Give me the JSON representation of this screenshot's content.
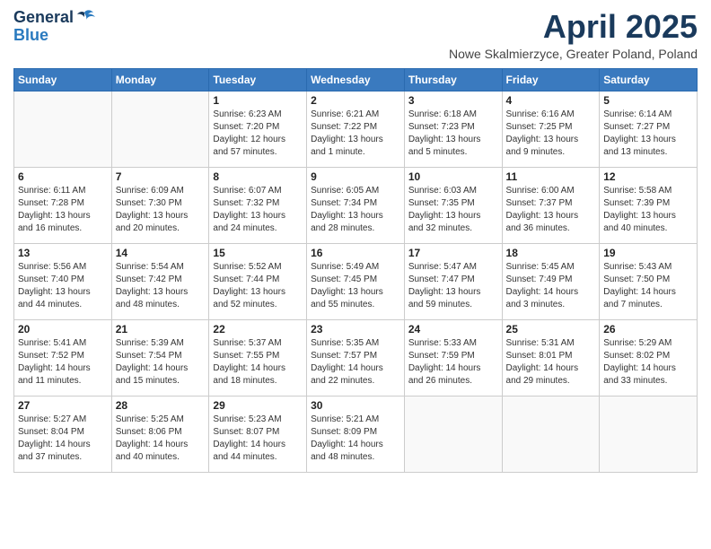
{
  "logo": {
    "general": "General",
    "blue": "Blue"
  },
  "title": "April 2025",
  "subtitle": "Nowe Skalmierzyce, Greater Poland, Poland",
  "days_of_week": [
    "Sunday",
    "Monday",
    "Tuesday",
    "Wednesday",
    "Thursday",
    "Friday",
    "Saturday"
  ],
  "weeks": [
    [
      {
        "day": "",
        "info": ""
      },
      {
        "day": "",
        "info": ""
      },
      {
        "day": "1",
        "info": "Sunrise: 6:23 AM\nSunset: 7:20 PM\nDaylight: 12 hours and 57 minutes."
      },
      {
        "day": "2",
        "info": "Sunrise: 6:21 AM\nSunset: 7:22 PM\nDaylight: 13 hours and 1 minute."
      },
      {
        "day": "3",
        "info": "Sunrise: 6:18 AM\nSunset: 7:23 PM\nDaylight: 13 hours and 5 minutes."
      },
      {
        "day": "4",
        "info": "Sunrise: 6:16 AM\nSunset: 7:25 PM\nDaylight: 13 hours and 9 minutes."
      },
      {
        "day": "5",
        "info": "Sunrise: 6:14 AM\nSunset: 7:27 PM\nDaylight: 13 hours and 13 minutes."
      }
    ],
    [
      {
        "day": "6",
        "info": "Sunrise: 6:11 AM\nSunset: 7:28 PM\nDaylight: 13 hours and 16 minutes."
      },
      {
        "day": "7",
        "info": "Sunrise: 6:09 AM\nSunset: 7:30 PM\nDaylight: 13 hours and 20 minutes."
      },
      {
        "day": "8",
        "info": "Sunrise: 6:07 AM\nSunset: 7:32 PM\nDaylight: 13 hours and 24 minutes."
      },
      {
        "day": "9",
        "info": "Sunrise: 6:05 AM\nSunset: 7:34 PM\nDaylight: 13 hours and 28 minutes."
      },
      {
        "day": "10",
        "info": "Sunrise: 6:03 AM\nSunset: 7:35 PM\nDaylight: 13 hours and 32 minutes."
      },
      {
        "day": "11",
        "info": "Sunrise: 6:00 AM\nSunset: 7:37 PM\nDaylight: 13 hours and 36 minutes."
      },
      {
        "day": "12",
        "info": "Sunrise: 5:58 AM\nSunset: 7:39 PM\nDaylight: 13 hours and 40 minutes."
      }
    ],
    [
      {
        "day": "13",
        "info": "Sunrise: 5:56 AM\nSunset: 7:40 PM\nDaylight: 13 hours and 44 minutes."
      },
      {
        "day": "14",
        "info": "Sunrise: 5:54 AM\nSunset: 7:42 PM\nDaylight: 13 hours and 48 minutes."
      },
      {
        "day": "15",
        "info": "Sunrise: 5:52 AM\nSunset: 7:44 PM\nDaylight: 13 hours and 52 minutes."
      },
      {
        "day": "16",
        "info": "Sunrise: 5:49 AM\nSunset: 7:45 PM\nDaylight: 13 hours and 55 minutes."
      },
      {
        "day": "17",
        "info": "Sunrise: 5:47 AM\nSunset: 7:47 PM\nDaylight: 13 hours and 59 minutes."
      },
      {
        "day": "18",
        "info": "Sunrise: 5:45 AM\nSunset: 7:49 PM\nDaylight: 14 hours and 3 minutes."
      },
      {
        "day": "19",
        "info": "Sunrise: 5:43 AM\nSunset: 7:50 PM\nDaylight: 14 hours and 7 minutes."
      }
    ],
    [
      {
        "day": "20",
        "info": "Sunrise: 5:41 AM\nSunset: 7:52 PM\nDaylight: 14 hours and 11 minutes."
      },
      {
        "day": "21",
        "info": "Sunrise: 5:39 AM\nSunset: 7:54 PM\nDaylight: 14 hours and 15 minutes."
      },
      {
        "day": "22",
        "info": "Sunrise: 5:37 AM\nSunset: 7:55 PM\nDaylight: 14 hours and 18 minutes."
      },
      {
        "day": "23",
        "info": "Sunrise: 5:35 AM\nSunset: 7:57 PM\nDaylight: 14 hours and 22 minutes."
      },
      {
        "day": "24",
        "info": "Sunrise: 5:33 AM\nSunset: 7:59 PM\nDaylight: 14 hours and 26 minutes."
      },
      {
        "day": "25",
        "info": "Sunrise: 5:31 AM\nSunset: 8:01 PM\nDaylight: 14 hours and 29 minutes."
      },
      {
        "day": "26",
        "info": "Sunrise: 5:29 AM\nSunset: 8:02 PM\nDaylight: 14 hours and 33 minutes."
      }
    ],
    [
      {
        "day": "27",
        "info": "Sunrise: 5:27 AM\nSunset: 8:04 PM\nDaylight: 14 hours and 37 minutes."
      },
      {
        "day": "28",
        "info": "Sunrise: 5:25 AM\nSunset: 8:06 PM\nDaylight: 14 hours and 40 minutes."
      },
      {
        "day": "29",
        "info": "Sunrise: 5:23 AM\nSunset: 8:07 PM\nDaylight: 14 hours and 44 minutes."
      },
      {
        "day": "30",
        "info": "Sunrise: 5:21 AM\nSunset: 8:09 PM\nDaylight: 14 hours and 48 minutes."
      },
      {
        "day": "",
        "info": ""
      },
      {
        "day": "",
        "info": ""
      },
      {
        "day": "",
        "info": ""
      }
    ]
  ]
}
